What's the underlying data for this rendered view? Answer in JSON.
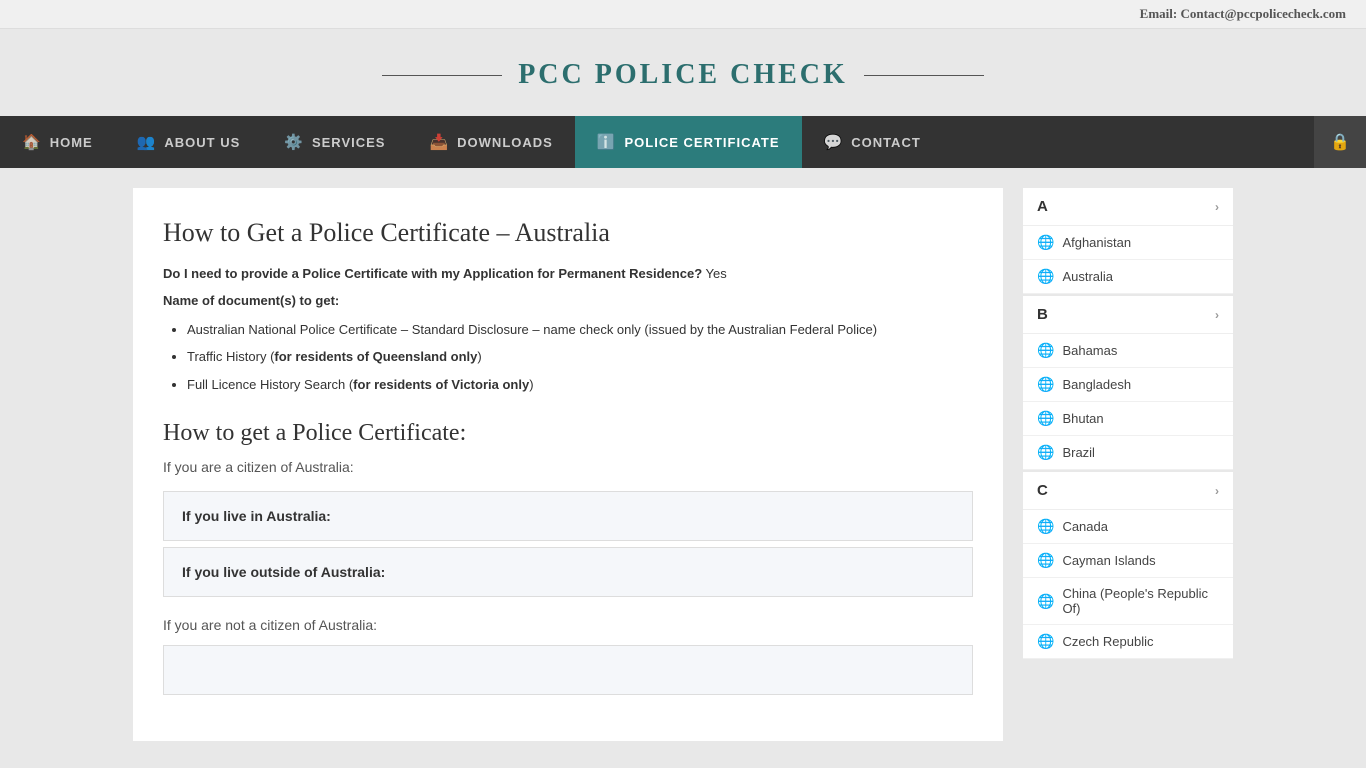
{
  "topbar": {
    "email_label": "Email:",
    "email_value": "Contact@pccpolicecheck.com"
  },
  "header": {
    "title": "PCC POLICE CHECK"
  },
  "nav": {
    "items": [
      {
        "id": "home",
        "icon": "🏠",
        "label": "HOME",
        "active": false
      },
      {
        "id": "about",
        "icon": "👥",
        "label": "ABOUT US",
        "active": false
      },
      {
        "id": "services",
        "icon": "⚙️",
        "label": "SERVICES",
        "active": false
      },
      {
        "id": "downloads",
        "icon": "📥",
        "label": "DOWNLOADS",
        "active": false
      },
      {
        "id": "police-certificate",
        "icon": "ℹ️",
        "label": "POLICE CERTIFICATE",
        "active": true
      },
      {
        "id": "contact",
        "icon": "💬",
        "label": "CONTACT",
        "active": false
      }
    ],
    "blog_icon": "🔒"
  },
  "main": {
    "page_title": "How to Get a Police Certificate – Australia",
    "intro_question": "Do I need to provide a Police Certificate with my Application for Permanent Residence?",
    "intro_answer": " Yes",
    "name_of_doc_label": "Name of document(s) to get:",
    "doc_list": [
      "Australian National Police Certificate – Standard Disclosure – name check only (issued by the Australian Federal Police)",
      "Traffic History (for residents of Queensland only)",
      "Full Licence History Search (for residents of Victoria only)"
    ],
    "how_to_title": "How to get a Police Certificate:",
    "citizen_subtitle": "If you are a citizen of Australia:",
    "accordion_items": [
      {
        "id": "live-in",
        "label": "If you live in Australia:"
      },
      {
        "id": "live-outside",
        "label": "If you live outside of Australia:"
      }
    ],
    "not_citizen_subtitle": "If you are not a citizen of Australia:",
    "accordion_items2": [
      {
        "id": "not-citizen",
        "label": ""
      }
    ]
  },
  "sidebar": {
    "sections": [
      {
        "letter": "A",
        "countries": [
          "Afghanistan",
          "Australia"
        ]
      },
      {
        "letter": "B",
        "countries": [
          "Bahamas",
          "Bangladesh",
          "Bhutan",
          "Brazil"
        ]
      },
      {
        "letter": "C",
        "countries": [
          "Canada",
          "Cayman Islands",
          "China (People's Republic Of)",
          "Czech Republic"
        ]
      }
    ]
  }
}
